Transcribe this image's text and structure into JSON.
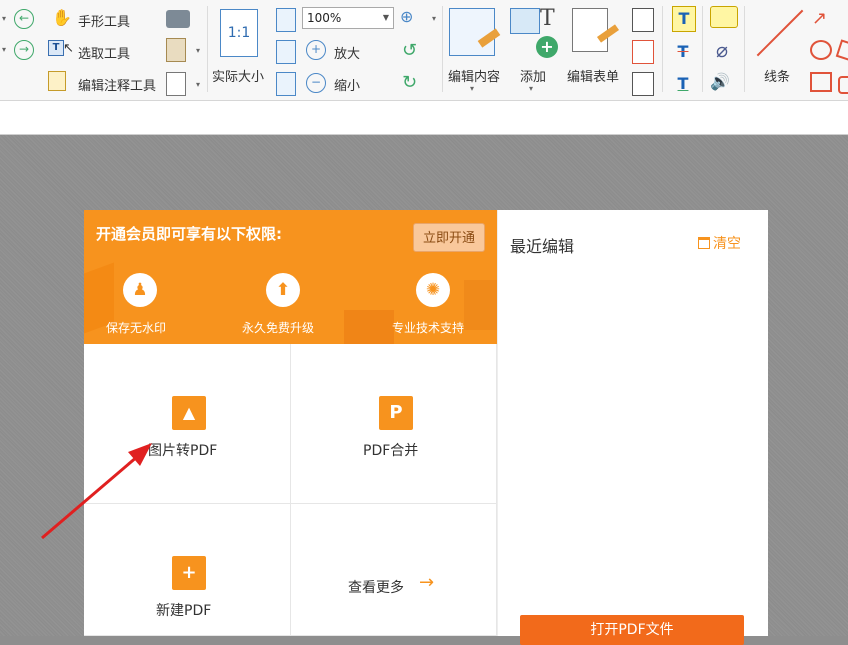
{
  "toolbar": {
    "hand_tool": "手形工具",
    "select_tool": "选取工具",
    "edit_annotation_tool": "编辑注释工具",
    "actual_size": "实际大小",
    "actual_size_icon": "1:1",
    "zoom_value": "100%",
    "zoom_in": "放大",
    "zoom_out": "缩小",
    "edit_content": "编辑内容",
    "add": "添加",
    "edit_form": "编辑表单",
    "lines": "线条"
  },
  "promo": {
    "title": "开通会员即可享有以下权限:",
    "open_button": "立即开通",
    "benefits": [
      {
        "label": "保存无水印",
        "icon": "stamp-icon"
      },
      {
        "label": "永久免费升级",
        "icon": "upgrade-arrow-icon"
      },
      {
        "label": "专业技术支持",
        "icon": "lightbulb-icon"
      }
    ]
  },
  "tiles": [
    {
      "label": "图片转PDF",
      "icon": "image-icon"
    },
    {
      "label": "PDF合并",
      "icon": "pdf-p-icon",
      "glyph": "P"
    },
    {
      "label": "新建PDF",
      "icon": "plus-icon",
      "glyph": "+"
    },
    {
      "label": "查看更多",
      "icon": "arrow-right-icon",
      "arrow": "→"
    }
  ],
  "recent": {
    "title": "最近编辑",
    "clear": "清空",
    "open_file_button": "打开PDF文件"
  },
  "colors": {
    "accent": "#f7931e",
    "button_orange": "#f26a1b",
    "annotation_arrow": "#e02020"
  }
}
